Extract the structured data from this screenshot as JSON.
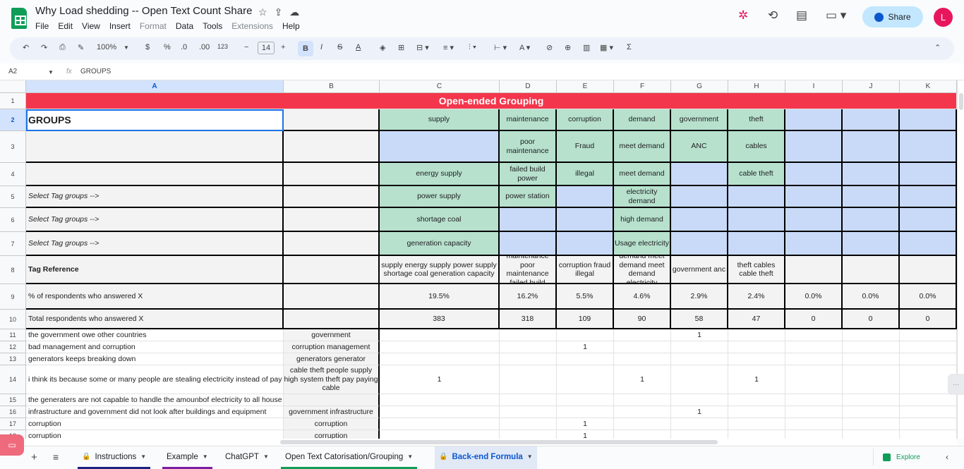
{
  "doc": {
    "title": "Why  Load shedding -- Open Text Count Share",
    "menu": [
      "File",
      "Edit",
      "View",
      "Insert",
      "Format",
      "Data",
      "Tools",
      "Extensions",
      "Help"
    ],
    "share_label": "Share",
    "avatar_letter": "L"
  },
  "toolbar": {
    "zoom": "100%",
    "currency": "$",
    "percent": "%",
    "decrease_decimal": ".0",
    "increase_decimal": ".00",
    "number_format": "123",
    "font_size": "14",
    "minus": "−",
    "plus": "+",
    "bold": "B",
    "italic": "I",
    "strike": "S",
    "text_color": "A",
    "sum": "Σ"
  },
  "formula_bar": {
    "cell_ref": "A2",
    "fx": "fx",
    "value": "GROUPS"
  },
  "columns": [
    "A",
    "B",
    "C",
    "D",
    "E",
    "F",
    "G",
    "H",
    "I",
    "J",
    "K"
  ],
  "rows": [
    "1",
    "2",
    "3",
    "4",
    "5",
    "6",
    "7",
    "8",
    "9",
    "10",
    "11",
    "12",
    "13",
    "14",
    "15",
    "16",
    "17",
    "18"
  ],
  "banner": "Open-ended Grouping",
  "groups_label": "GROUPS",
  "grid": {
    "r2": [
      "supply",
      "maintenance",
      "corruption",
      "demand",
      "government",
      "theft",
      "",
      "",
      ""
    ],
    "r3": [
      "",
      "poor maintenance",
      "Fraud",
      "meet demand",
      "ANC",
      "cables",
      "",
      "",
      ""
    ],
    "r4": [
      "energy supply",
      "failed build power",
      "illegal",
      "meet demand",
      "",
      "cable theft",
      "",
      "",
      ""
    ],
    "r5": [
      "power supply",
      "power station",
      "",
      "electricity demand",
      "",
      "",
      "",
      "",
      ""
    ],
    "r6": [
      "shortage coal",
      "",
      "",
      "high demand",
      "",
      "",
      "",
      "",
      ""
    ],
    "r7": [
      "generation capacity",
      "",
      "",
      "Usage electricity",
      "",
      "",
      "",
      "",
      ""
    ],
    "r8": [
      "supply  energy supply power supply shortage coal generation capacity",
      "maintenance poor maintenance failed build",
      "corruption fraud illegal",
      "demand meet demand meet demand electricity",
      "government anc",
      "theft cables cable theft",
      "",
      "",
      ""
    ],
    "r9": [
      "19.5%",
      "16.2%",
      "5.5%",
      "4.6%",
      "2.9%",
      "2.4%",
      "0.0%",
      "0.0%",
      "0.0%"
    ],
    "r10": [
      "383",
      "318",
      "109",
      "90",
      "58",
      "47",
      "0",
      "0",
      "0"
    ]
  },
  "labels": {
    "r5": "Select Tag groups -->",
    "r6": "Select Tag groups -->",
    "r7": "Select Tag groups -->",
    "r8": "Tag Reference",
    "r9": "% of respondents who answered X",
    "r10": "Total respondents who answered X"
  },
  "responses": [
    {
      "row": "11",
      "text": "the government owe other countries",
      "tags": "government",
      "marks": {
        "G": "1"
      }
    },
    {
      "row": "12",
      "text": "bad management and corruption",
      "tags": "corruption management",
      "marks": {
        "E": "1"
      }
    },
    {
      "row": "13",
      "text": "generators keeps breaking down",
      "tags": "generators generator",
      "marks": {}
    },
    {
      "row": "14",
      "text": "i think its because some or many people are stealing electricity instead of pay",
      "tags": "cable theft people supply high system theft pay paying cable",
      "marks": {
        "C": "1",
        "F": "1",
        "H": "1"
      }
    },
    {
      "row": "15",
      "text": "the generaters are not capable to handle the amounbof electricity to all house",
      "tags": "",
      "marks": {}
    },
    {
      "row": "16",
      "text": "infrastructure and government did not look after buildings and equipment",
      "tags": "government infrastructure",
      "marks": {
        "G": "1"
      }
    },
    {
      "row": "17",
      "text": "corruption",
      "tags": "corruption",
      "marks": {
        "E": "1"
      }
    },
    {
      "row": "18",
      "text": "corruption",
      "tags": "corruption",
      "marks": {
        "E": "1"
      }
    }
  ],
  "sheet_tabs": [
    {
      "label": "Instructions",
      "locked": true,
      "active": false,
      "color": "#1a237e"
    },
    {
      "label": "Example",
      "locked": false,
      "active": false,
      "color": "#7b1fa2"
    },
    {
      "label": "ChatGPT",
      "locked": false,
      "active": false,
      "color": ""
    },
    {
      "label": "Open Text Catorisation/Grouping",
      "locked": false,
      "active": false,
      "color": "#0f9d58"
    },
    {
      "label": "Back-end Formula",
      "locked": true,
      "active": true,
      "color": ""
    }
  ],
  "explore_label": "Explore",
  "colors": {
    "banner": "#f4364c",
    "green": "#b7e1cd",
    "blue": "#c9daf8",
    "accent": "#0b57d0"
  }
}
